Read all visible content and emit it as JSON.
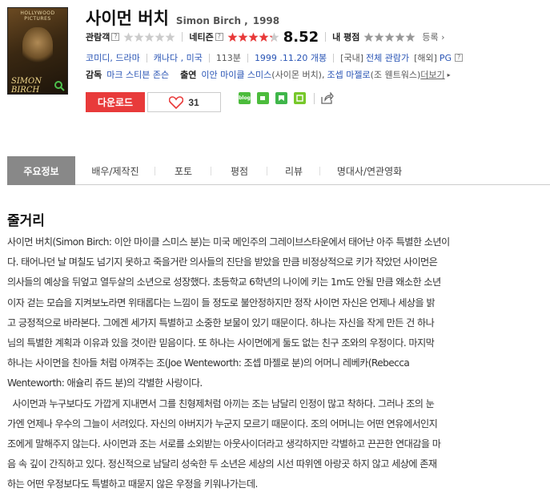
{
  "poster": {
    "top_text": "HOLLYWOOD PICTURES",
    "name_text": "SIMON BIRCH",
    "zoom_icon": "magnifier-icon"
  },
  "movie": {
    "title_ko": "사이먼 버치",
    "title_en": "Simon Birch ,",
    "year": "1998"
  },
  "ratings": {
    "audience_label": "관람객",
    "netizen_label": "네티즌",
    "netizen_score": "8.52",
    "netizen_stars_filled": 4.25,
    "my_label": "내 평점",
    "register_label": "등록",
    "star_color": "#e83a3a",
    "empty_star_color": "#cccccc",
    "my_star_color": "#999999"
  },
  "info": {
    "genre": "코미디, 드라마",
    "country": "캐나다 , 미국",
    "runtime": "113분",
    "release": "1999 .11.20 개봉",
    "grade_kr_label": "[국내]",
    "grade_kr": "전체 관람가",
    "grade_intl_label": "[해외]",
    "grade_intl": "PG"
  },
  "credits": {
    "director_label": "감독",
    "director": "마크 스티븐 존슨",
    "cast_label": "출연",
    "actor1": "이안 마이클 스미스",
    "role1": "(사이몬 버치),",
    "actor2": "조셉 마젤로",
    "role2": "(조 웬트워스)",
    "more": "더보기"
  },
  "actions": {
    "download": "다운로드",
    "likes": "31",
    "sns_blog": "blog"
  },
  "tabs": [
    "주요정보",
    "배우/제작진",
    "포토",
    "평점",
    "리뷰",
    "명대사/연관영화"
  ],
  "synopsis_title": "줄거리",
  "synopsis_lines": [
    "사이먼 버치(Simon Birch: 이안 마이클 스미스 분)는 미국 메인주의 그레이브스타운에서 태어난 아주 특별한 소년이",
    "다. 태어나던 날 며칠도 넘기지 못하고 죽을거란 의사들의 진단을 받았을 만큼 비정상적으로 키가 작았던 사이먼은",
    "의사들의 예상을 뒤엎고 열두살의 소년으로 성장했다. 초등학교 6학년의 나이에 키는 1m도 안될 만큼 왜소한 소년",
    "이자 걷는 모습을 지켜보노라면 위태롭다는 느낌이 들 정도로 불안정하지만 정작 사이먼 자신은 언제나 세상을 밝",
    "고 긍정적으로 바라본다. 그에겐 세가지 특별하고 소중한 보물이 있기 때문이다. 하나는 자신을 작게 만든 건 하나",
    "님의 특별한 계획과 이유과 있을 것이란 믿음이다. 또 하나는 사이먼에게 둘도 없는 친구 조와의 우정이다. 마지막",
    "하나는 사이먼을 친아들 처럼 아껴주는 조(Joe Wenteworth: 조셉 마젤로 분)의 어머니 레베카(Rebecca",
    "Wenteworth: 애슐리 쥬드 분)의 각별한 사랑이다.",
    "  사이먼과 누구보다도 가깝게 지내면서 그를 친형제처럼 아끼는 조는 남달리 인정이 많고 착하다. 그러나 조의 눈",
    "가엔 언제나 우수의 그늘이 서려있다. 자신의 아버지가 누군지 모르기 때문이다. 조의 어머니는 어떤 연유에서인지",
    "조에게 말해주지 않는다. 사이먼과 조는 서로를 소외받는 아웃사이더라고 생각하지만 각별하고 끈끈한 연대감을 마",
    "음 속 깊이 간직하고 있다. 정신적으로 남달리 성숙한 두 소년은 세상의 시선 따위엔 아랑곳 하지 않고 세상에 존재",
    "하는 어떤 우정보다도 특별하고 때묻지 않은 우정을 키워나가는데."
  ]
}
